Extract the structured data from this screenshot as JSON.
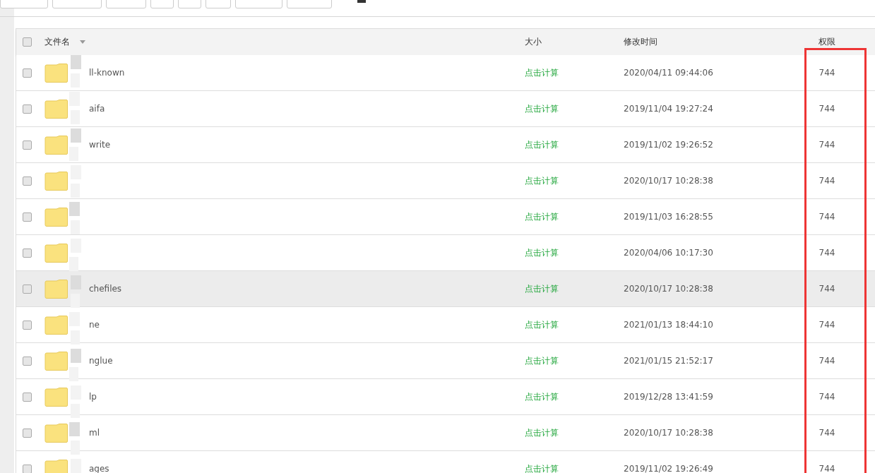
{
  "table": {
    "columns": [
      "文件名",
      "大小",
      "修改时间",
      "权限"
    ],
    "select_all": {
      "checked": false
    },
    "rows": [
      {
        "name": "ll-known",
        "size": "点击计算",
        "modified": "2020/04/11 09:44:06",
        "permissions": "744",
        "checked": false,
        "highlighted": false
      },
      {
        "name": "aifa",
        "size": "点击计算",
        "modified": "2019/11/04 19:27:24",
        "permissions": "744",
        "checked": false,
        "highlighted": false
      },
      {
        "name": "write",
        "size": "点击计算",
        "modified": "2019/11/02 19:26:52",
        "permissions": "744",
        "checked": false,
        "highlighted": false
      },
      {
        "size": "点击计算",
        "modified": "2020/10/17 10:28:38",
        "permissions": "744",
        "checked": false,
        "highlighted": false
      },
      {
        "size": "点击计算",
        "modified": "2019/11/03 16:28:55",
        "permissions": "744",
        "checked": false,
        "highlighted": false
      },
      {
        "size": "点击计算",
        "modified": "2020/04/06 10:17:30",
        "permissions": "744",
        "checked": false,
        "highlighted": false
      },
      {
        "name": "chefiles",
        "size": "点击计算",
        "modified": "2020/10/17 10:28:38",
        "permissions": "744",
        "checked": false,
        "highlighted": true
      },
      {
        "name": "ne",
        "size": "点击计算",
        "modified": "2021/01/13 18:44:10",
        "permissions": "744",
        "checked": false,
        "highlighted": false
      },
      {
        "name": "nglue",
        "size": "点击计算",
        "modified": "2021/01/15 21:52:17",
        "permissions": "744",
        "checked": false,
        "highlighted": false
      },
      {
        "name": "lp",
        "size": "点击计算",
        "modified": "2019/12/28 13:41:59",
        "permissions": "744",
        "checked": false,
        "highlighted": false
      },
      {
        "name": "ml",
        "size": "点击计算",
        "modified": "2020/10/17 10:28:38",
        "permissions": "744",
        "checked": false,
        "highlighted": false
      },
      {
        "name": "ages",
        "size": "点击计算",
        "modified": "2019/11/02 19:26:49",
        "permissions": "744",
        "checked": false,
        "highlighted": false
      }
    ]
  }
}
